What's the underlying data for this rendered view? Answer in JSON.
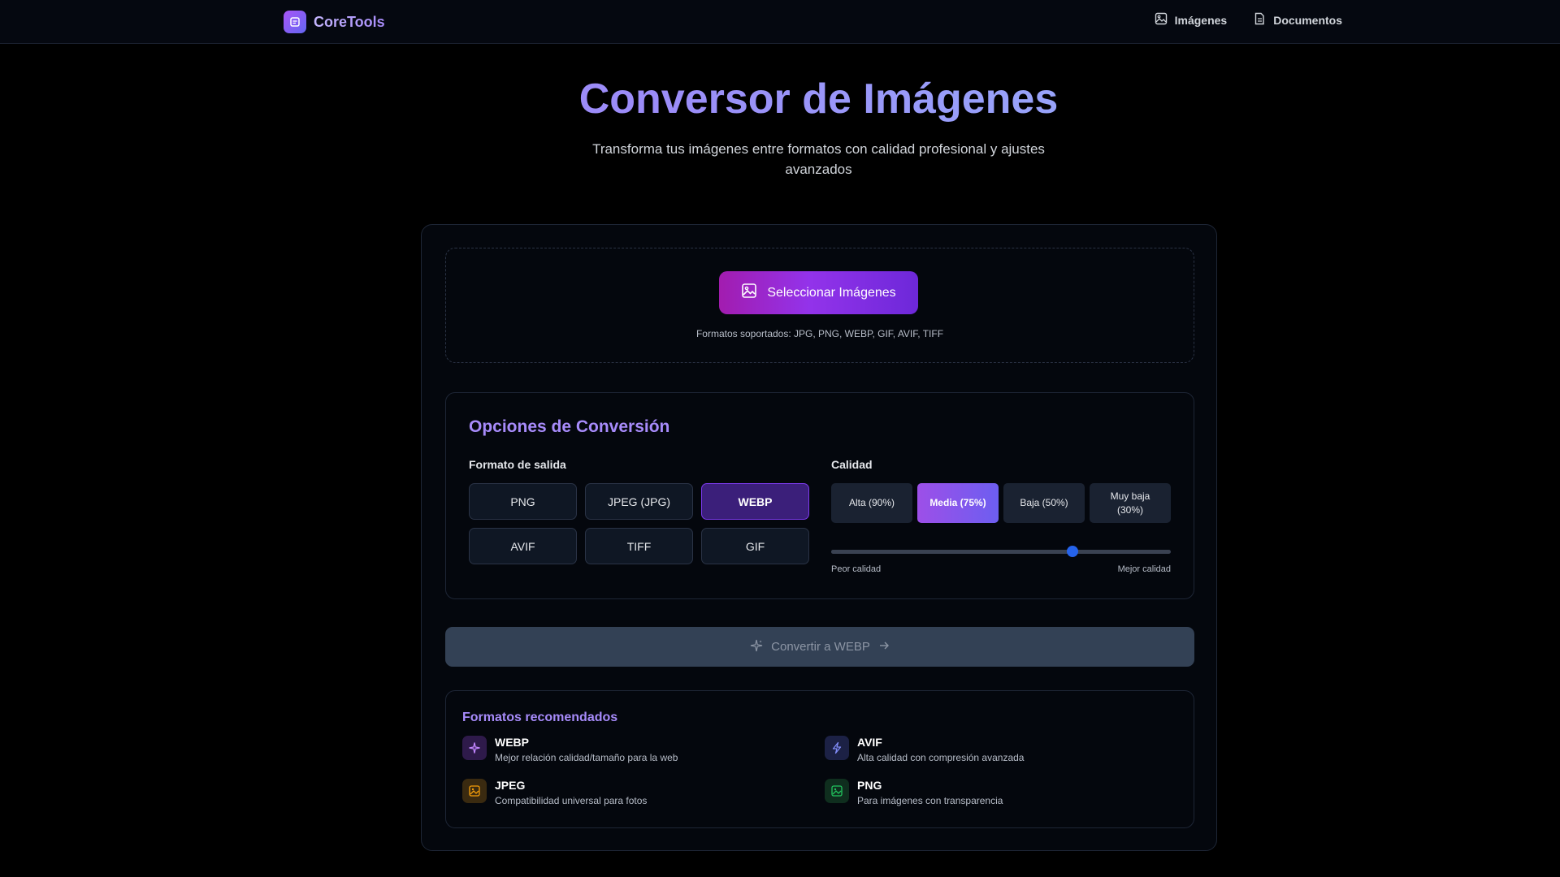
{
  "header": {
    "brand": "CoreTools",
    "nav": [
      {
        "label": "Imágenes",
        "icon": "image-icon"
      },
      {
        "label": "Documentos",
        "icon": "document-icon"
      }
    ]
  },
  "hero": {
    "title": "Conversor de Imágenes",
    "subtitle": "Transforma tus imágenes entre formatos con calidad profesional y ajustes avanzados"
  },
  "upload": {
    "button_label": "Seleccionar Imágenes",
    "supported_formats": "Formatos soportados: JPG, PNG, WEBP, GIF, AVIF, TIFF"
  },
  "options": {
    "title": "Opciones de Conversión",
    "output_format_label": "Formato de salida",
    "formats": [
      "PNG",
      "JPEG (JPG)",
      "WEBP",
      "AVIF",
      "TIFF",
      "GIF"
    ],
    "selected_format": "WEBP",
    "quality_label": "Calidad",
    "quality_presets": [
      "Alta (90%)",
      "Media (75%)",
      "Baja (50%)",
      "Muy baja (30%)"
    ],
    "selected_quality": "Media (75%)",
    "quality_value": 0.71,
    "slider_min_label": "Peor calidad",
    "slider_max_label": "Mejor calidad"
  },
  "convert": {
    "label": "Convertir a WEBP"
  },
  "recommended": {
    "title": "Formatos recomendados",
    "items": [
      {
        "name": "WEBP",
        "description": "Mejor relación calidad/tamaño para la web",
        "icon": "sparkles-icon",
        "color": "#c084fc"
      },
      {
        "name": "AVIF",
        "description": "Alta calidad con compresión avanzada",
        "icon": "bolt-icon",
        "color": "#818cf8"
      },
      {
        "name": "JPEG",
        "description": "Compatibilidad universal para fotos",
        "icon": "image-icon",
        "color": "#f59e0b"
      },
      {
        "name": "PNG",
        "description": "Para imágenes con transparencia",
        "icon": "image-icon",
        "color": "#22c55e"
      }
    ]
  },
  "colors": {
    "accent": "#a78bfa",
    "primary_button": "#9333ea",
    "slider_thumb": "#2563eb",
    "background": "#000000"
  }
}
